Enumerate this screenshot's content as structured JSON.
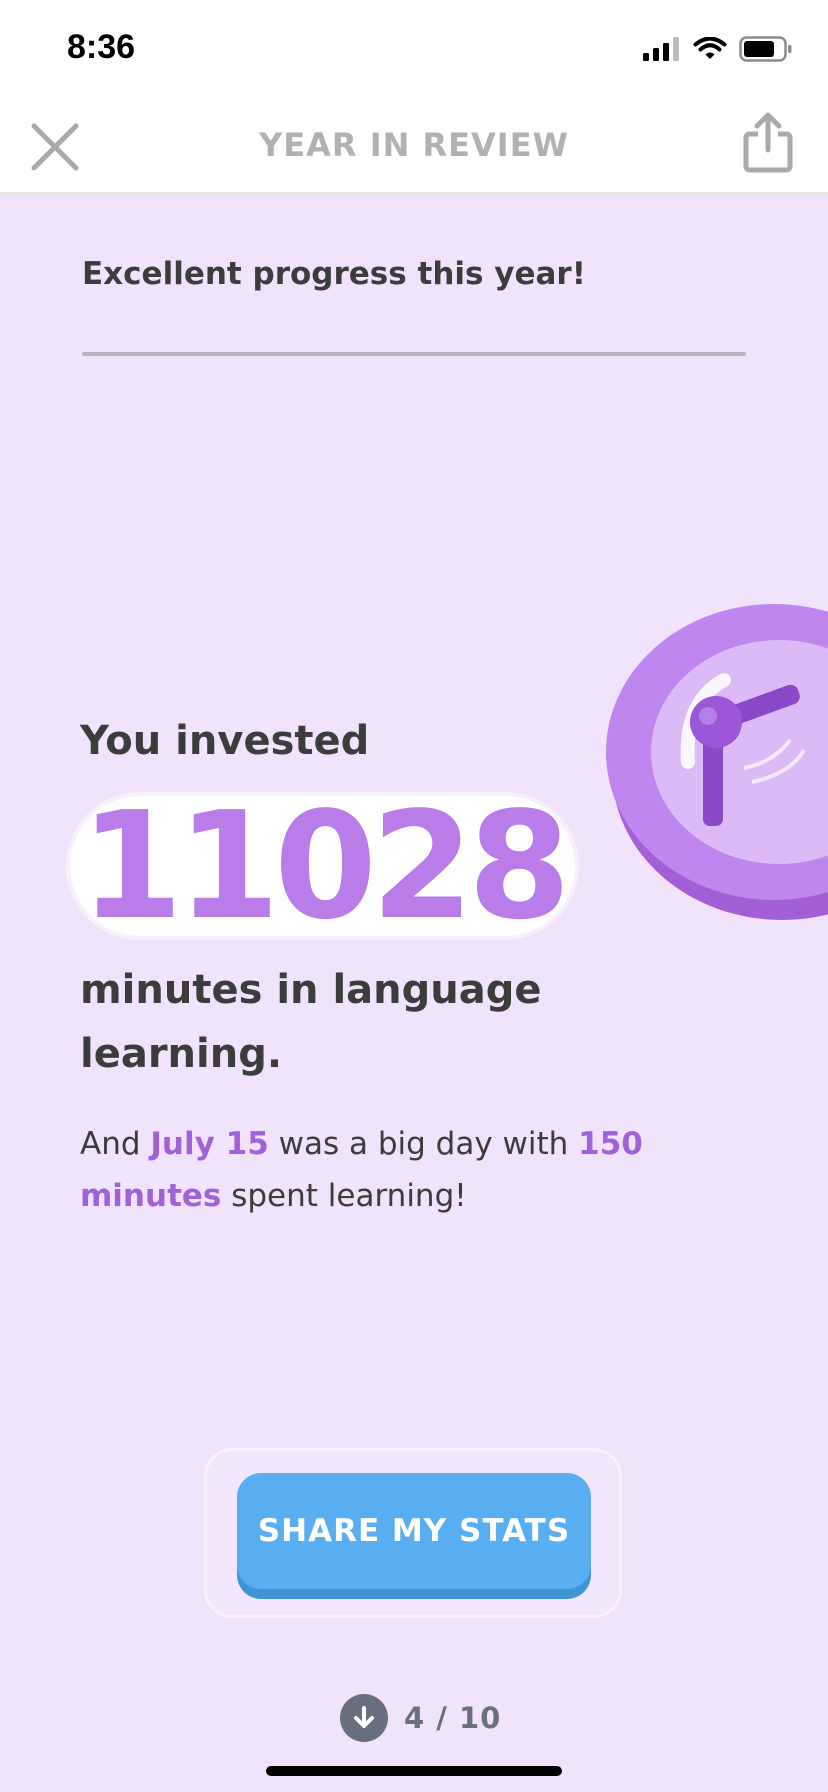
{
  "status_bar": {
    "time": "8:36",
    "icons": [
      "signal-icon",
      "wifi-icon",
      "battery-icon"
    ]
  },
  "nav": {
    "title": "YEAR IN REVIEW",
    "close_icon": "close-icon",
    "share_icon": "share-icon"
  },
  "content": {
    "headline": "Excellent progress this year!",
    "invested_label": "You invested",
    "minutes_total": "11028",
    "minutes_label": "minutes in language learning.",
    "detail": {
      "part1": "And ",
      "highlight_date": "July 15",
      "part2": " was a big day with ",
      "highlight_minutes": "150 minutes",
      "part3": " spent learning!"
    },
    "illustration": "clock-icon"
  },
  "actions": {
    "share_stats_label": "SHARE MY STATS"
  },
  "pager": {
    "label": "4 / 10",
    "icon": "arrow-down-icon"
  },
  "colors": {
    "background": "#f1e3fb",
    "accent_purple": "#b97ce9",
    "highlight_purple": "#9f62d8",
    "button_blue": "#58aef0"
  }
}
